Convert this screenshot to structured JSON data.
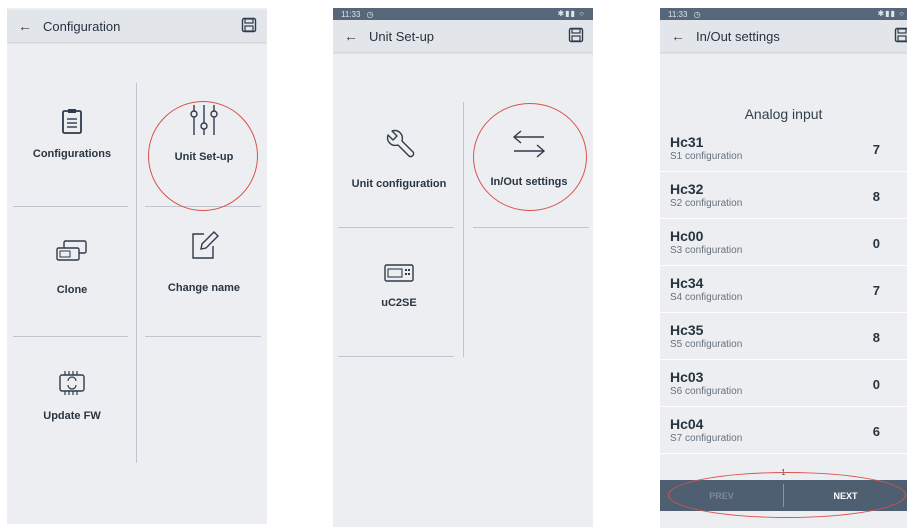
{
  "screen1": {
    "title": "Configuration",
    "tiles": {
      "configurations": "Configurations",
      "unit_setup": "Unit Set-up",
      "clone": "Clone",
      "change_name": "Change name",
      "update_fw": "Update FW"
    }
  },
  "screen2": {
    "status_time": "11:33",
    "title": "Unit Set-up",
    "tiles": {
      "unit_configuration": "Unit configuration",
      "inout_settings": "In/Out settings",
      "device": "uC2SE"
    }
  },
  "screen3": {
    "status_time": "11:33",
    "title": "In/Out settings",
    "section_title": "Analog input",
    "rows": [
      {
        "code": "Hc31",
        "desc": "S1 configuration",
        "value": "7"
      },
      {
        "code": "Hc32",
        "desc": "S2 configuration",
        "value": "8"
      },
      {
        "code": "Hc00",
        "desc": "S3 configuration",
        "value": "0"
      },
      {
        "code": "Hc34",
        "desc": "S4 configuration",
        "value": "7"
      },
      {
        "code": "Hc35",
        "desc": "S5 configuration",
        "value": "8"
      },
      {
        "code": "Hc03",
        "desc": "S6 configuration",
        "value": "0"
      },
      {
        "code": "Hc04",
        "desc": "S7 configuration",
        "value": "6"
      }
    ],
    "page_number": "1",
    "prev_label": "PREV",
    "next_label": "NEXT"
  },
  "colors": {
    "background": "#eceef1",
    "appbar": "#e2e5e9",
    "statusbar": "#566779",
    "pager": "#4e5f71",
    "highlight_circle": "#d9534f"
  },
  "icons": [
    "back-arrow-icon",
    "save-icon",
    "clipboard-icon",
    "sliders-icon",
    "clone-icon",
    "edit-icon",
    "chip-icon",
    "wrench-icon",
    "swap-arrows-icon",
    "device-icon"
  ]
}
